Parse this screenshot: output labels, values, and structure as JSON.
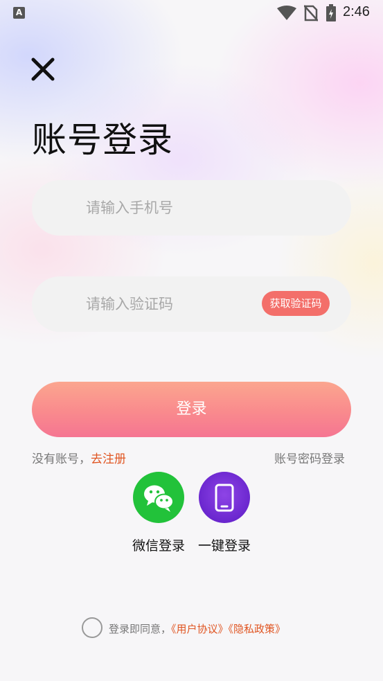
{
  "status_bar": {
    "app_indicator": "A",
    "time": "2:46",
    "icons": [
      "wifi-icon",
      "no-sim-icon",
      "battery-charging-icon"
    ]
  },
  "header": {
    "close_icon": "close-icon",
    "title": "账号登录"
  },
  "form": {
    "phone_placeholder": "请输入手机号",
    "phone_value": "",
    "code_placeholder": "请输入验证码",
    "code_value": "",
    "get_code_label": "获取验证码",
    "login_label": "登录"
  },
  "links": {
    "no_account_text": "没有账号，",
    "register_label": "去注册",
    "password_login_label": "账号密码登录"
  },
  "social": {
    "wechat_label": "微信登录",
    "wechat_icon": "wechat-icon",
    "onekey_label": "一键登录",
    "onekey_icon": "phone-icon"
  },
  "agreement": {
    "checked": false,
    "prefix": "登录即同意，",
    "user_agreement": "《用户协议》",
    "privacy_policy": "《隐私政策》"
  },
  "colors": {
    "accent": "#e05522",
    "code_button": "#f36f6a",
    "login_gradient_top": "#fba68f",
    "login_gradient_bottom": "#f57592",
    "wechat_green": "#22c23a",
    "onekey_purple": "#7a2fdc"
  }
}
